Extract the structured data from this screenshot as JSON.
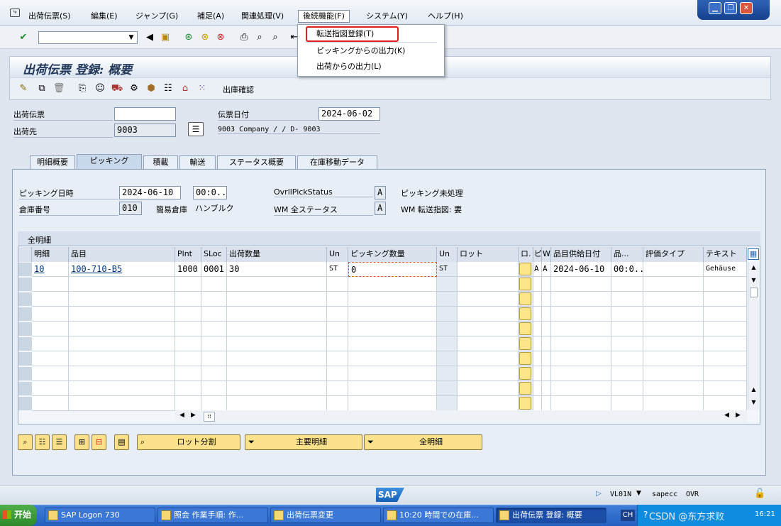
{
  "menu": {
    "items": [
      "出荷伝票(S)",
      "編集(E)",
      "ジャンプ(G)",
      "補足(A)",
      "関連処理(V)",
      "後続機能(F)",
      "システム(Y)",
      "ヘルプ(H)"
    ],
    "dropdown": [
      "転送指図登録(T)",
      "ピッキングからの出力(K)",
      "出荷からの出力(L)"
    ]
  },
  "title": "出荷伝票 登録: 概要",
  "toolbar2": {
    "label": "出庫確認"
  },
  "header": {
    "delivery_label": "出荷伝票",
    "delivery_value": "",
    "shipto_label": "出荷先",
    "shipto_value": "9003",
    "docdate_label": "伝票日付",
    "docdate_value": "2024-06-02",
    "shipto_desc": "9003 Company / / D- 9003"
  },
  "tabs": [
    "明細概要",
    "ピッキング",
    "積載",
    "輸送",
    "ステータス概要",
    "在庫移動データ"
  ],
  "picking": {
    "date_label": "ピッキング日時",
    "date_value": "2024-06-10",
    "time_value": "00:0...",
    "warehouse_label": "倉庫番号",
    "warehouse_value": "010",
    "simple_label": "簡易倉庫",
    "simple_value": "ハンブルク",
    "ovrl_label": "OvrllPickStatus",
    "ovrl_value": "A",
    "ovrl_text": "ピッキング未処理",
    "wm_label": "WM 全ステータス",
    "wm_value": "A",
    "wm_text": "WM 転送指図: 要"
  },
  "table": {
    "title": "全明細",
    "columns": [
      "明細",
      "品目",
      "Plnt",
      "SLoc",
      "出荷数量",
      "Un",
      "ピッキング数量",
      "Un",
      "ロット",
      "ロ.",
      "ピ",
      "W.",
      "品目供給日付",
      "品...",
      "評価タイプ",
      "テキスト"
    ],
    "row": [
      "10",
      "100-710-B5",
      "1000",
      "0001",
      "30",
      "ST",
      "0",
      "ST",
      "",
      "",
      "A",
      "A",
      "2024-06-10",
      "00:0...",
      "",
      "Gehäuse"
    ]
  },
  "buttons": {
    "batch": "ロット分割",
    "main": "主要明細",
    "all": "全明細"
  },
  "status": {
    "tcode": "VL01N",
    "server": "sapecc",
    "mode": "OVR"
  },
  "taskbar": {
    "start": "开始",
    "tasks": [
      "SAP Logon 730",
      "照会 作業手順: 作...",
      "出荷伝票変更",
      "10:20 時間での在庫...",
      "出荷伝票 登録: 概要"
    ],
    "lang": "CH",
    "clock": "16:21",
    "watermark": "CSDN @东方求败"
  }
}
